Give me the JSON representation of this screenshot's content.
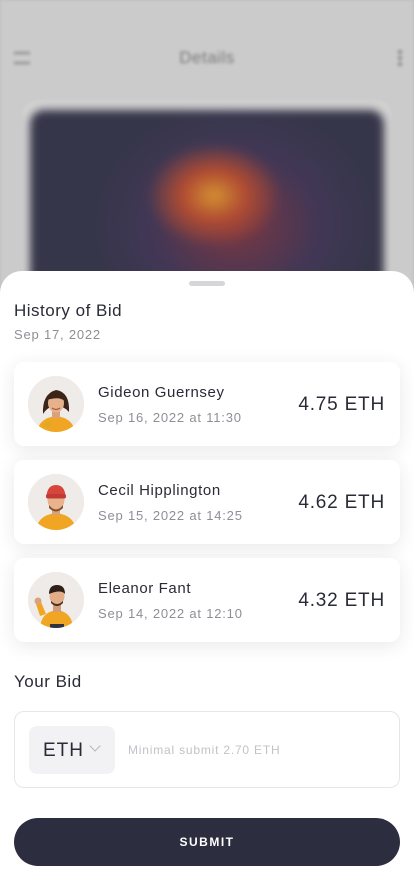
{
  "background": {
    "title": "Details"
  },
  "sheet": {
    "title": "History of Bid",
    "date": "Sep 17, 2022"
  },
  "bids": [
    {
      "name": "Gideon Guernsey",
      "time": "Sep 16, 2022 at 11:30",
      "amount": "4.75 ETH"
    },
    {
      "name": "Cecil Hipplington",
      "time": "Sep 15, 2022 at 14:25",
      "amount": "4.62 ETH"
    },
    {
      "name": "Eleanor Fant",
      "time": "Sep 14, 2022 at 12:10",
      "amount": "4.32 ETH"
    }
  ],
  "your_bid": {
    "label": "Your Bid",
    "currency": "ETH",
    "placeholder": "Minimal submit 2.70 ETH"
  },
  "submit_label": "SUBMIT",
  "colors": {
    "primary": "#2c2d3e",
    "sweater": "#f0a623"
  }
}
